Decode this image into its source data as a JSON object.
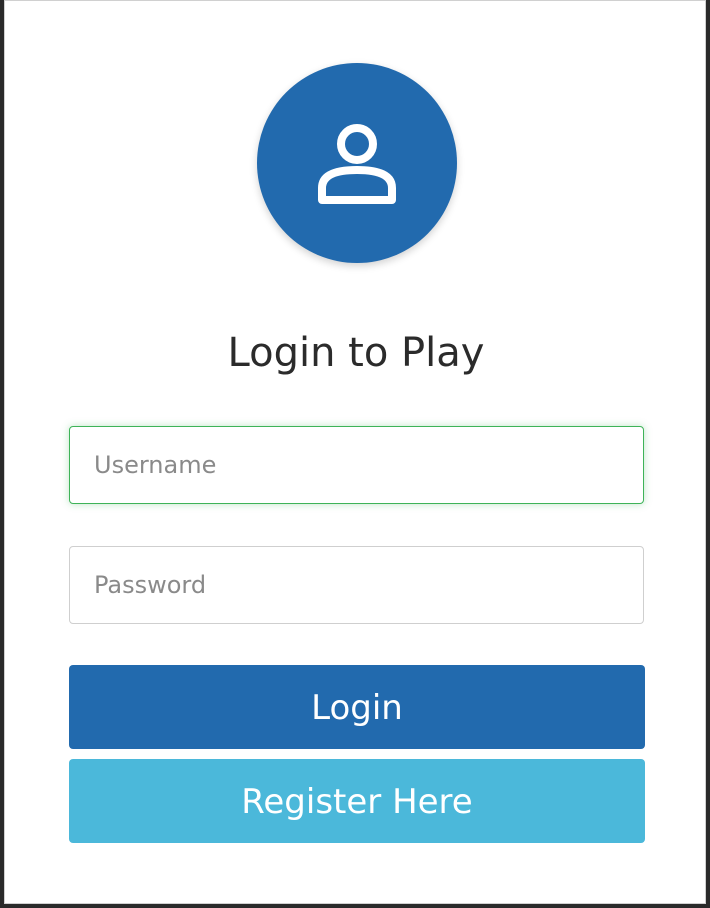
{
  "login": {
    "title": "Login to Play",
    "username_placeholder": "Username",
    "password_placeholder": "Password",
    "login_label": "Login",
    "register_label": "Register Here"
  },
  "colors": {
    "primary": "#226aae",
    "secondary": "#4bb8da",
    "focus": "#3eb358"
  },
  "icons": {
    "avatar": "user-icon"
  }
}
